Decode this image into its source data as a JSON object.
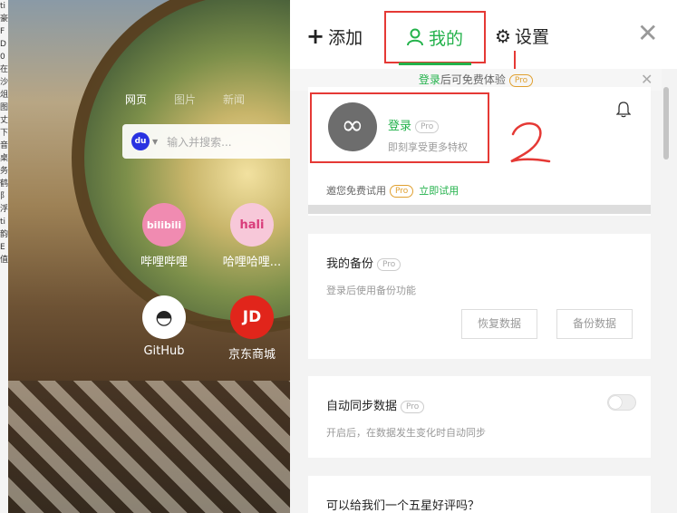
{
  "left_strip": [
    "ti",
    "豪",
    "F",
    "D",
    "0",
    "在",
    "沙",
    "俎",
    "图",
    "丈",
    "下",
    "音",
    "桌",
    "务",
    "鹤",
    "阝",
    "浮",
    "ti",
    "韵",
    "E",
    "值"
  ],
  "newtab": {
    "nav_tabs": [
      "网页",
      "图片",
      "新闻"
    ],
    "search": {
      "engine_badge": "du",
      "placeholder": "输入并搜索..."
    },
    "shortcuts": [
      {
        "label": "哔哩哔哩",
        "icon_text": "bilibili"
      },
      {
        "label": "哈哩哈哩...",
        "icon_text": "hali"
      },
      {
        "label": "GitHub",
        "icon_text": "◓"
      },
      {
        "label": "京东商城",
        "icon_text": "JD"
      }
    ]
  },
  "panel": {
    "tabs": {
      "add": "添加",
      "mine": "我的",
      "settings": "设置"
    },
    "banner": {
      "link": "登录",
      "text": "后可免费体验",
      "pro": "Pro"
    },
    "login_card": {
      "login_label": "登录",
      "pro": "Pro",
      "subtitle": "即刻享受更多特权",
      "invite_text": "邀您免费试用",
      "invite_pro": "Pro",
      "try_now": "立即试用",
      "progress": 0
    },
    "backup_card": {
      "title": "我的备份",
      "pro": "Pro",
      "desc": "登录后使用备份功能",
      "restore_btn": "恢复数据",
      "backup_btn": "备份数据"
    },
    "sync_card": {
      "title": "自动同步数据",
      "pro": "Pro",
      "desc": "开启后，在数据发生变化时自动同步",
      "enabled": false
    },
    "rate_card": {
      "title": "可以给我们一个五星好评吗？"
    }
  },
  "colors": {
    "accent": "#23b24b",
    "annotation": "#e53935"
  }
}
